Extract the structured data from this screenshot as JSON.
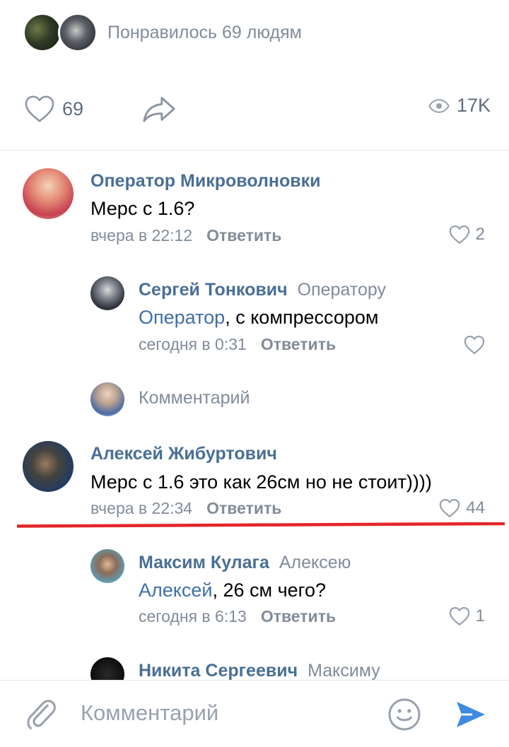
{
  "likes_summary": {
    "text": "Понравилось 69 людям"
  },
  "post_actions": {
    "likes_count": "69",
    "views_count": "17K"
  },
  "comments": [
    {
      "author": "Оператор Микроволновки",
      "text": "Мерс с 1.6?",
      "time": "вчера в 22:12",
      "reply_label": "Ответить",
      "likes": "2"
    },
    {
      "author": "Сергей Тонкович",
      "reply_to": "Оператору",
      "mention": "Оператор",
      "text": ", с компрессором",
      "time": "сегодня в 0:31",
      "reply_label": "Ответить",
      "likes": ""
    },
    {
      "author": "Алексей Жибуртович",
      "text": "Мерс с 1.6 это как 26см но не стоит))))",
      "time": "вчера в 22:34",
      "reply_label": "Ответить",
      "likes": "44"
    },
    {
      "author": "Максим Кулага",
      "reply_to": "Алексею",
      "mention": "Алексей",
      "text": ", 26 см чего?",
      "time": "сегодня в 6:13",
      "reply_label": "Ответить",
      "likes": "1"
    },
    {
      "author": "Никита Сергеевич",
      "reply_to": "Максиму"
    }
  ],
  "thread_reply": {
    "placeholder": "Комментарий"
  },
  "composer": {
    "placeholder": "Комментарий"
  },
  "colors": {
    "link": "#4a6f96",
    "muted": "#818c99",
    "send": "#3f8ae0",
    "highlight": "#e3262b"
  },
  "icons": [
    "heart-icon",
    "share-icon",
    "eye-icon",
    "paperclip-icon",
    "smile-icon",
    "send-icon"
  ]
}
